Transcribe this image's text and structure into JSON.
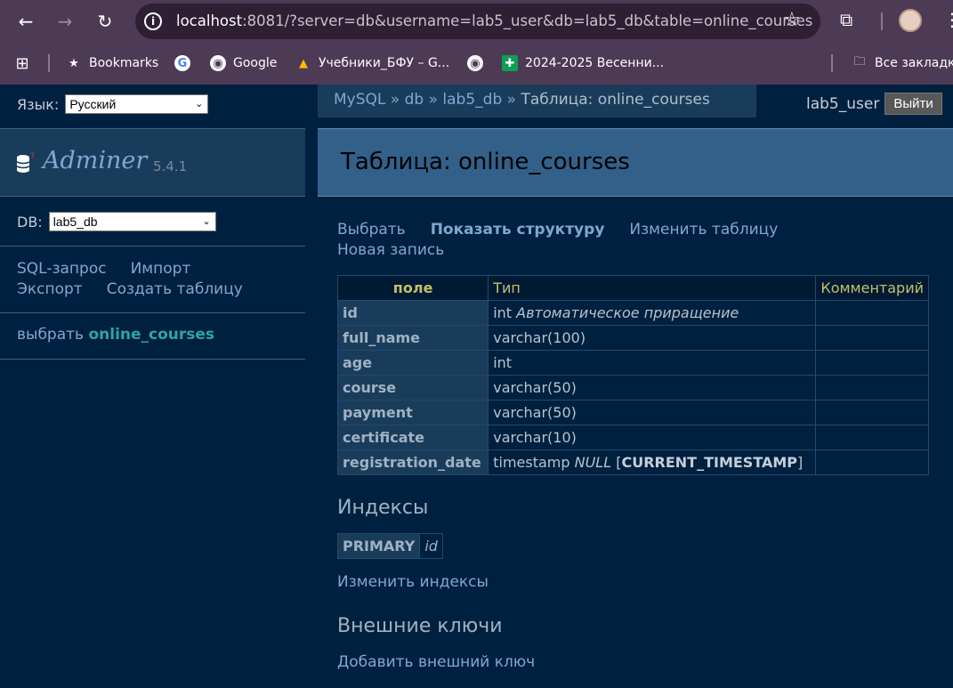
{
  "browser": {
    "url_host": "localhost",
    "url_rest": ":8081/?server=db&username=lab5_user&db=lab5_db&table=online_courses",
    "bookmarks": [
      {
        "label": "Bookmarks",
        "icon": "star-icon"
      },
      {
        "label": "Google",
        "icon": "google-icon"
      },
      {
        "label": "Учебники_БФУ – G...",
        "icon": "drive-icon"
      },
      {
        "label": "2024-2025 Весенни...",
        "icon": "sheets-icon"
      }
    ],
    "all_bookmarks": "Все закладки"
  },
  "lang": {
    "label": "Язык:",
    "value": "Русский"
  },
  "breadcrumb": {
    "mysql": "MySQL",
    "sep": "»",
    "server": "db",
    "db": "lab5_db",
    "current": "Таблица: online_courses"
  },
  "user": {
    "name": "lab5_user",
    "logout": "Выйти"
  },
  "logo": {
    "name": "Adminer",
    "version": "5.4.1"
  },
  "db_select": {
    "label": "DB:",
    "value": "lab5_db"
  },
  "menu": {
    "sql": "SQL-запрос",
    "import": "Импорт",
    "export": "Экспорт",
    "create": "Создать таблицу"
  },
  "tables": {
    "select": "выбрать",
    "name": "online_courses"
  },
  "title": "Таблица: online_courses",
  "actions": {
    "select": "Выбрать",
    "structure": "Показать структуру",
    "alter": "Изменить таблицу",
    "new": "Новая запись"
  },
  "structure": {
    "headers": [
      "поле",
      "Тип",
      "Комментарий"
    ],
    "rows": [
      {
        "field": "id",
        "type": "int",
        "extra": "Автоматическое приращение",
        "comment": ""
      },
      {
        "field": "full_name",
        "type": "varchar(100)",
        "extra": "",
        "comment": ""
      },
      {
        "field": "age",
        "type": "int",
        "extra": "",
        "comment": ""
      },
      {
        "field": "course",
        "type": "varchar(50)",
        "extra": "",
        "comment": ""
      },
      {
        "field": "payment",
        "type": "varchar(50)",
        "extra": "",
        "comment": ""
      },
      {
        "field": "certificate",
        "type": "varchar(10)",
        "extra": "",
        "comment": ""
      },
      {
        "field": "registration_date",
        "type": "timestamp",
        "extra": "NULL",
        "default": "CURRENT_TIMESTAMP",
        "comment": ""
      }
    ]
  },
  "indexes": {
    "title": "Индексы",
    "type": "PRIMARY",
    "column": "id",
    "alter": "Изменить индексы"
  },
  "foreign": {
    "title": "Внешние ключи",
    "add": "Добавить внешний ключ"
  }
}
